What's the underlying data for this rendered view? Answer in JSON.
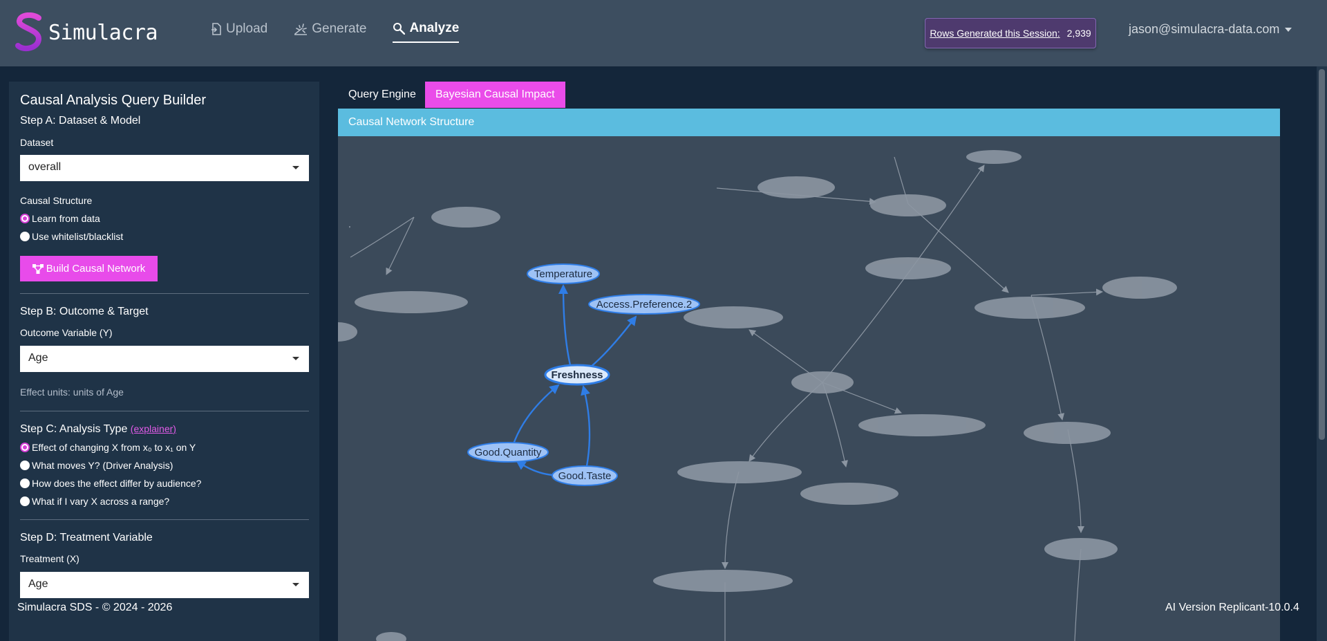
{
  "brand": {
    "name": "Simulacra",
    "logo": "simulacra-logo"
  },
  "nav": {
    "upload": "Upload",
    "generate": "Generate",
    "analyze": "Analyze"
  },
  "session": {
    "label": "Rows Generated this Session:",
    "count": "2,939"
  },
  "user": {
    "email": "jason@simulacra-data.com"
  },
  "sidebar": {
    "title": "Causal Analysis Query Builder",
    "stepA": {
      "heading": "Step A: Dataset & Model",
      "dataset_label": "Dataset",
      "dataset_value": "overall",
      "structure_label": "Causal Structure",
      "opt_learn": "Learn from data",
      "opt_whitelist": "Use whitelist/blacklist",
      "build_button": "Build Causal Network"
    },
    "stepB": {
      "heading": "Step B: Outcome & Target",
      "outcome_label": "Outcome Variable (Y)",
      "outcome_value": "Age",
      "units_note": "Effect units: units of Age"
    },
    "stepC": {
      "heading": "Step C: Analysis Type",
      "explainer": "(explainer)",
      "opt1": "Effect of changing X from x₀ to x₁ on Y",
      "opt2": "What moves Y? (Driver Analysis)",
      "opt3": "How does the effect differ by audience?",
      "opt4": "What if I vary X across a range?"
    },
    "stepD": {
      "heading": "Step D: Treatment Variable",
      "treatment_label": "Treatment (X)",
      "treatment_value": "Age"
    }
  },
  "tabs": {
    "query_engine": "Query Engine",
    "bayesian": "Bayesian Causal Impact"
  },
  "card": {
    "header": "Causal Network Structure"
  },
  "graph": {
    "highlight_color": "#2f7de6",
    "node_fill": "#9ec2f5",
    "focus_node": "Freshness",
    "nodes": {
      "temperature": "Temperature",
      "access_pref": "Access.Preference.2",
      "freshness": "Freshness",
      "good_quantity": "Good.Quantity",
      "good_taste": "Good.Taste"
    }
  },
  "footer": {
    "left": "Simulacra SDS - © 2024 - 2026",
    "right": "AI Version Replicant-10.0.4"
  }
}
